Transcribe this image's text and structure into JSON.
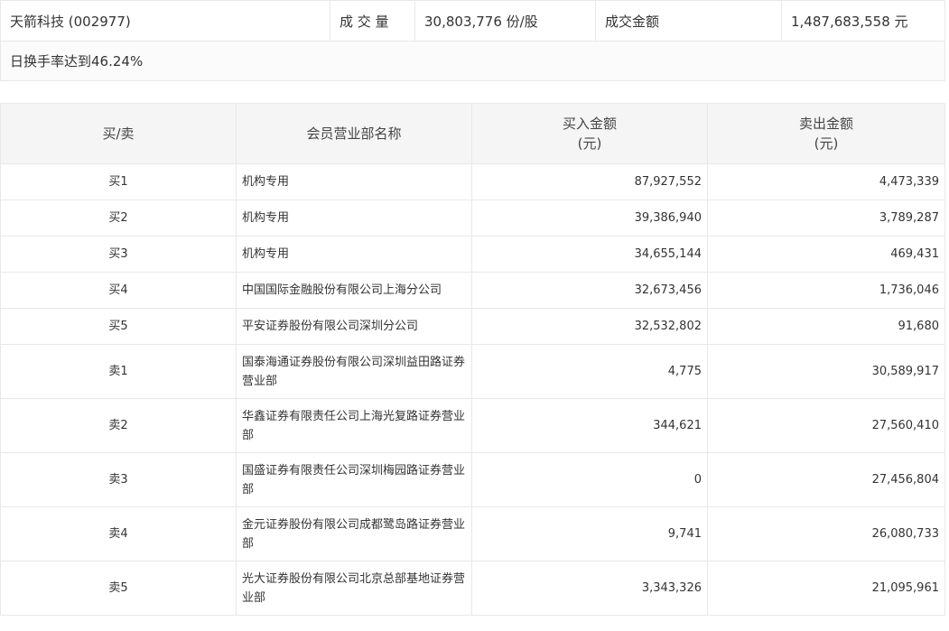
{
  "summary": {
    "stock": "天箭科技 (002977)",
    "volume_label": "成 交 量",
    "volume_value": "30,803,776 份/股",
    "amount_label": "成交金额",
    "amount_value": "1,487,683,558 元",
    "turnover_note": "日换手率达到46.24%"
  },
  "table": {
    "headers": {
      "side": "买/卖",
      "name": "会员营业部名称",
      "buy_line1": "买入金额",
      "buy_line2": "(元)",
      "sell_line1": "卖出金额",
      "sell_line2": "(元)"
    },
    "rows": [
      {
        "side": "买1",
        "name": "机构专用",
        "buy": "87,927,552",
        "sell": "4,473,339"
      },
      {
        "side": "买2",
        "name": "机构专用",
        "buy": "39,386,940",
        "sell": "3,789,287"
      },
      {
        "side": "买3",
        "name": "机构专用",
        "buy": "34,655,144",
        "sell": "469,431"
      },
      {
        "side": "买4",
        "name": "中国国际金融股份有限公司上海分公司",
        "buy": "32,673,456",
        "sell": "1,736,046"
      },
      {
        "side": "买5",
        "name": "平安证券股份有限公司深圳分公司",
        "buy": "32,532,802",
        "sell": "91,680"
      },
      {
        "side": "卖1",
        "name": "国泰海通证券股份有限公司深圳益田路证券营业部",
        "buy": "4,775",
        "sell": "30,589,917"
      },
      {
        "side": "卖2",
        "name": "华鑫证券有限责任公司上海光复路证券营业部",
        "buy": "344,621",
        "sell": "27,560,410"
      },
      {
        "side": "卖3",
        "name": "国盛证券有限责任公司深圳梅园路证券营业部",
        "buy": "0",
        "sell": "27,456,804"
      },
      {
        "side": "卖4",
        "name": "金元证券股份有限公司成都鹭岛路证券营业部",
        "buy": "9,741",
        "sell": "26,080,733"
      },
      {
        "side": "卖5",
        "name": "光大证券股份有限公司北京总部基地证券营业部",
        "buy": "3,343,326",
        "sell": "21,095,961"
      }
    ]
  }
}
